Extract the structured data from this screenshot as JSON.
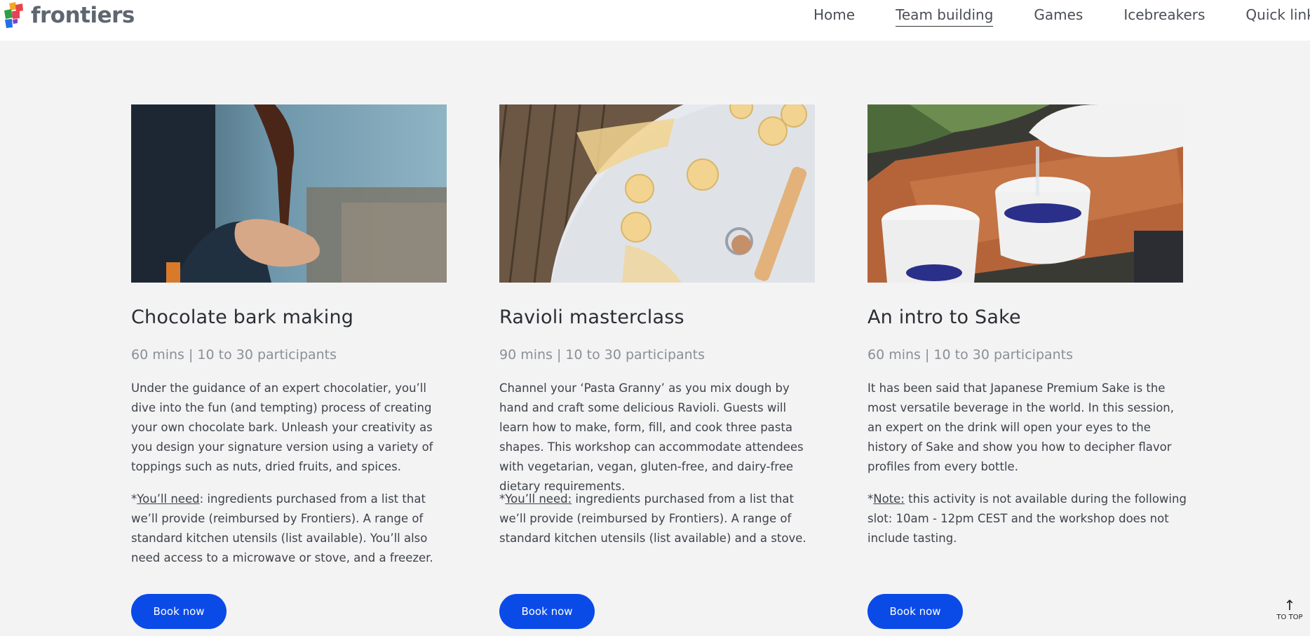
{
  "header": {
    "logo_text": "frontiers",
    "nav": [
      {
        "label": "Home",
        "active": false
      },
      {
        "label": "Team building",
        "active": true
      },
      {
        "label": "Games",
        "active": false
      },
      {
        "label": "Icebreakers",
        "active": false
      },
      {
        "label": "Quick links",
        "active": false
      }
    ]
  },
  "cards": [
    {
      "title": "Chocolate bark making",
      "meta": "60 mins | 10 to 30 participants",
      "description": "Under the guidance of an expert chocolatier, you’ll dive into the fun (and tempting) process of creating your own chocolate bark. Unleash your creativity as you design your signature version using a variety of toppings such as nuts, dried fruits, and spices.",
      "note_prefix": "*",
      "note_label": "You’ll need",
      "note_text": ": ingredients purchased from a list that we’ll provide (reimbursed by Frontiers). A range of standard kitchen utensils (list available). You’ll also need access to a microwave or stove, and a freezer.",
      "button_label": "Book now",
      "image": "chocolate-pour-photo"
    },
    {
      "title": "Ravioli masterclass",
      "meta": "90 mins | 10 to 30 participants",
      "description": "Channel your ‘Pasta Granny’ as you mix dough by hand and craft some delicious Ravioli. Guests will learn how to make, form, fill, and cook three pasta shapes. This workshop can accommodate attendees with vegetarian, vegan, gluten-free, and dairy-free dietary requirements.",
      "note_prefix": "*",
      "note_label": "You’ll need:",
      "note_text": " ingredients purchased from a list that we’ll provide (reimbursed by Frontiers). A range of standard kitchen utensils (list available) and a stove.",
      "button_label": "Book now",
      "image": "ravioli-photo"
    },
    {
      "title": "An intro to Sake",
      "meta": "60 mins | 10 to 30 participants",
      "description": "It has been said that Japanese Premium Sake is the most versatile beverage in the world. In this session, an expert on the drink will open your eyes to the history of Sake and show you how to decipher flavor profiles from every bottle.",
      "note_prefix": "*",
      "note_label": "Note:",
      "note_text": " this activity is not available during the following slot: 10am - 12pm CEST and the workshop does not include tasting.",
      "button_label": "Book now",
      "image": "sake-pour-photo"
    }
  ],
  "to_top": {
    "label": "TO TOP",
    "icon": "arrow-up-icon"
  },
  "colors": {
    "accent": "#0a4be8",
    "background": "#f3f3f4",
    "header_bg": "#ffffff"
  }
}
